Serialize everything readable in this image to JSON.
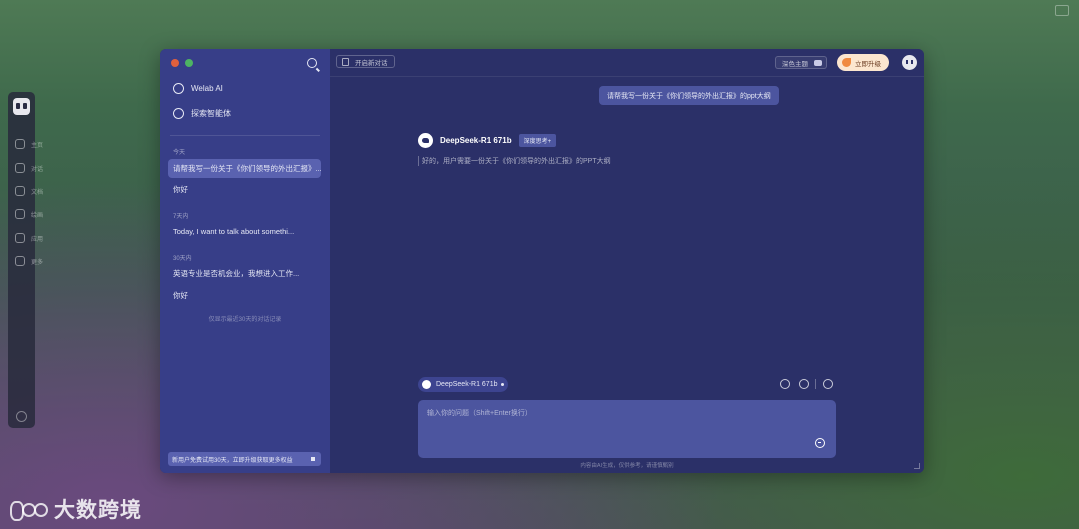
{
  "sidebar": {
    "nav": [
      {
        "label": "Welab AI",
        "icon": "assistant-icon"
      },
      {
        "label": "探索智能体",
        "icon": "explore-icon"
      }
    ],
    "sections": [
      {
        "label": "今天",
        "items": [
          "请帮我写一份关于《你们领导的外出汇报》...",
          "你好"
        ]
      },
      {
        "label": "7天内",
        "items": [
          "Today, I want to talk about somethi..."
        ]
      },
      {
        "label": "30天内",
        "items": [
          "英语专业是否机会业，我想进入工作...",
          "你好"
        ]
      }
    ],
    "note": "仅显示最近30天的对话记录",
    "bottom_notice": "新用户免费试用30天，立即升级获取更多权益"
  },
  "topbar": {
    "new_chat_label": "开启新对话",
    "theme_label": "深色主题",
    "upgrade_label": "立即升级"
  },
  "chat": {
    "user_message": "请帮我写一份关于《你们领导的外出汇报》的ppt大纲",
    "model_name": "DeepSeek-R1 671b",
    "model_tag": "深度思考+",
    "thinking_text": "好的，用户需要一份关于《你们领导的外出汇报》的PPT大纲"
  },
  "composer": {
    "model_select_label": "DeepSeek-R1 671b",
    "placeholder": "输入你的问题（Shift+Enter换行）",
    "disclaimer": "内容由AI生成，仅供参考，请谨慎甄别"
  },
  "dock": {
    "items": [
      "主页",
      "对话",
      "文档",
      "绘画",
      "应用",
      "更多"
    ]
  },
  "watermark": {
    "text": "大数跨境"
  },
  "colors": {
    "sidebar_bg": "#373e88",
    "main_bg": "#2b3068",
    "active_item": "#5a62b0",
    "upgrade_bg": "#fce6cf"
  }
}
